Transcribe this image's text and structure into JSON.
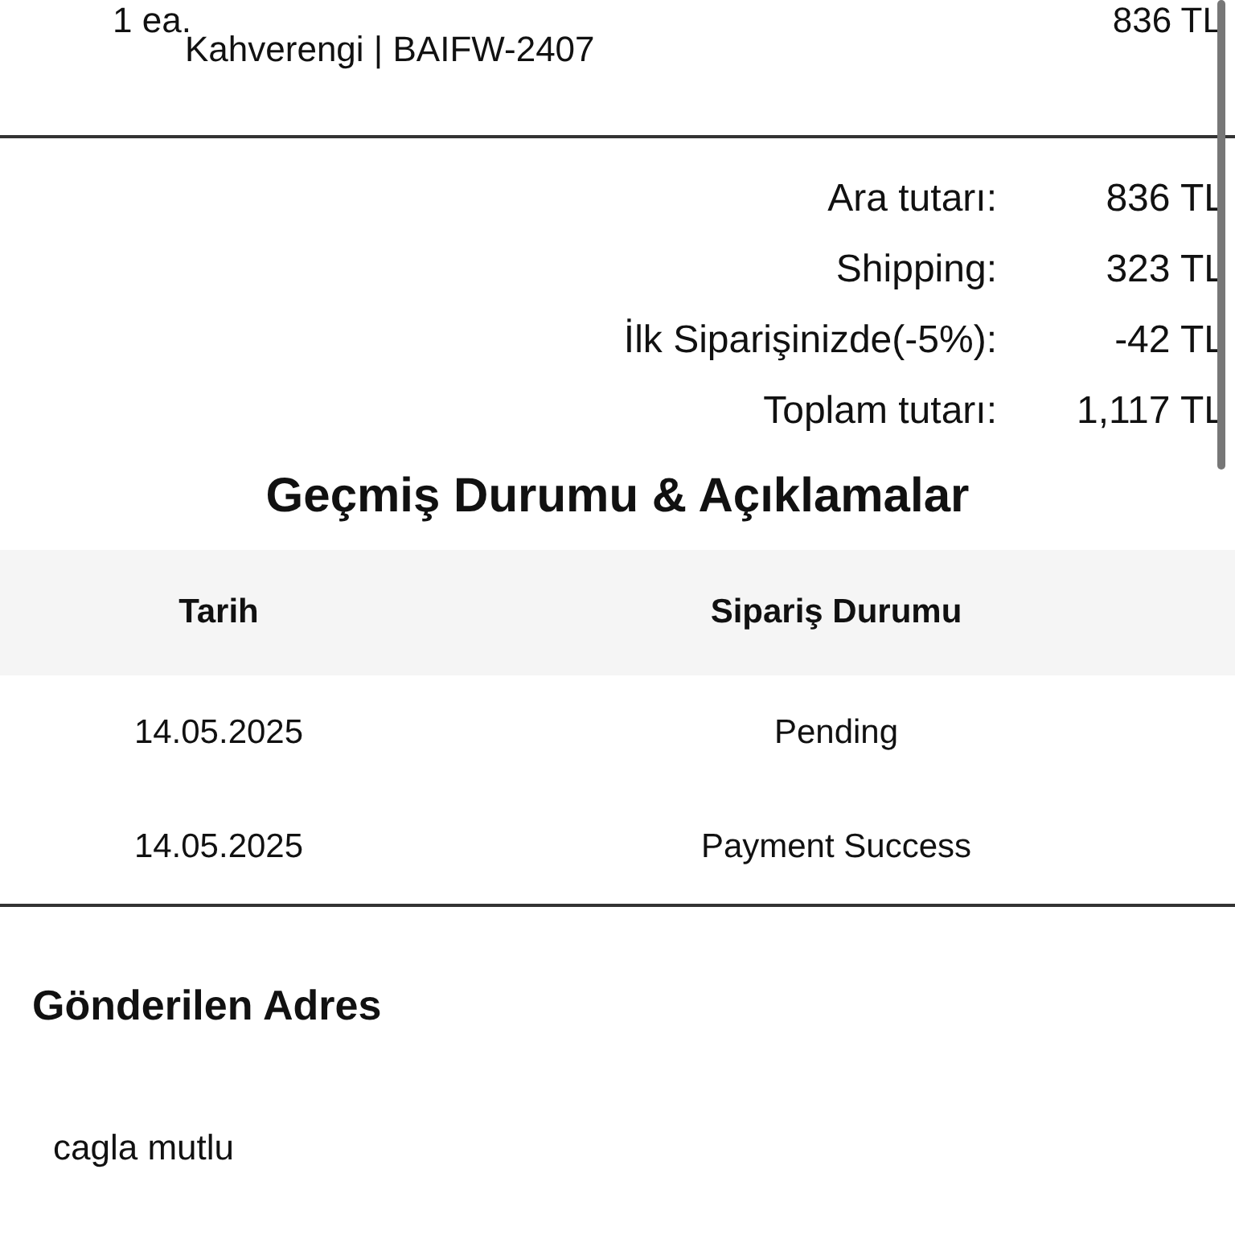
{
  "order_item": {
    "quantity": "1 ea.",
    "variant": "Kahverengi | BAIFW-2407",
    "price": "836 TL"
  },
  "summary": [
    {
      "label": "Ara tutarı:",
      "value": "836 TL"
    },
    {
      "label": "Shipping:",
      "value": "323 TL"
    },
    {
      "label": "İlk Siparişinizde(-5%):",
      "value": "-42 TL"
    },
    {
      "label": "Toplam tutarı:",
      "value": "1,117 TL"
    }
  ],
  "history": {
    "title": "Geçmiş Durumu & Açıklamalar",
    "columns": [
      "Tarih",
      "Sipariş Durumu"
    ],
    "rows": [
      [
        "14.05.2025",
        "Pending"
      ],
      [
        "14.05.2025",
        "Payment Success"
      ]
    ]
  },
  "address": {
    "title": "Gönderilen Adres",
    "name": "cagla mutlu"
  }
}
